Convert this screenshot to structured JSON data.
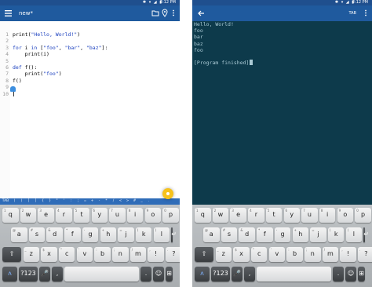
{
  "status": {
    "time": "2:12 PM",
    "icons": "✱ ▾ ◢ ▮"
  },
  "editor_screen": {
    "title": "new*",
    "line_numbers": [
      "1",
      "2",
      "3",
      "4",
      "5",
      "6",
      "7",
      "8",
      "9",
      "10"
    ],
    "code_lines": [
      "print(\"Hello, World!\")",
      "",
      "for i in [\"foo\", \"bar\", \"baz\"]:",
      "    print(i)",
      "",
      "def f():",
      "    print(\"foo\")",
      "f()",
      "",
      ""
    ],
    "extra_keys": [
      "TAB",
      "(",
      ")",
      "[",
      "]",
      "{",
      "}",
      "\"",
      "'",
      ":",
      ";",
      "=",
      "+",
      "-",
      "*",
      "/",
      "<",
      ">",
      "#",
      "_",
      "."
    ]
  },
  "console_screen": {
    "tab_label": "TAB",
    "output_lines": [
      "Hello, World!",
      "foo",
      "bar",
      "baz",
      "foo",
      "",
      "[Program finished]"
    ]
  },
  "keyboard": {
    "row1": [
      {
        "key": "q",
        "hint": "1"
      },
      {
        "key": "w",
        "hint": "2"
      },
      {
        "key": "e",
        "hint": "3"
      },
      {
        "key": "r",
        "hint": "4"
      },
      {
        "key": "t",
        "hint": "5"
      },
      {
        "key": "y",
        "hint": "6"
      },
      {
        "key": "u",
        "hint": "7"
      },
      {
        "key": "i",
        "hint": "8"
      },
      {
        "key": "o",
        "hint": "9"
      },
      {
        "key": "p",
        "hint": "0"
      }
    ],
    "row2": [
      {
        "key": "a",
        "hint": "@"
      },
      {
        "key": "s",
        "hint": "#"
      },
      {
        "key": "d",
        "hint": "&"
      },
      {
        "key": "f",
        "hint": "*"
      },
      {
        "key": "g",
        "hint": "-"
      },
      {
        "key": "h",
        "hint": "+"
      },
      {
        "key": "j",
        "hint": "="
      },
      {
        "key": "k",
        "hint": "("
      },
      {
        "key": "l",
        "hint": ")"
      }
    ],
    "row3": [
      {
        "key": "z",
        "hint": "_"
      },
      {
        "key": "x",
        "hint": "$"
      },
      {
        "key": "c",
        "hint": "\""
      },
      {
        "key": "v",
        "hint": "'"
      },
      {
        "key": "b",
        "hint": ":"
      },
      {
        "key": "n",
        "hint": ";"
      },
      {
        "key": "m",
        "hint": "/"
      },
      {
        "key": "!",
        "hint": ","
      },
      {
        "key": "?",
        "hint": "."
      }
    ],
    "backspace": "⌫",
    "enter": "↵",
    "shift": "⇧",
    "symbols": "?123",
    "mic": "🎤",
    "comma": ",",
    "period": ".",
    "emoji": "☺",
    "keyboard_switch": "⊞",
    "swype_logo": "ʌ"
  }
}
